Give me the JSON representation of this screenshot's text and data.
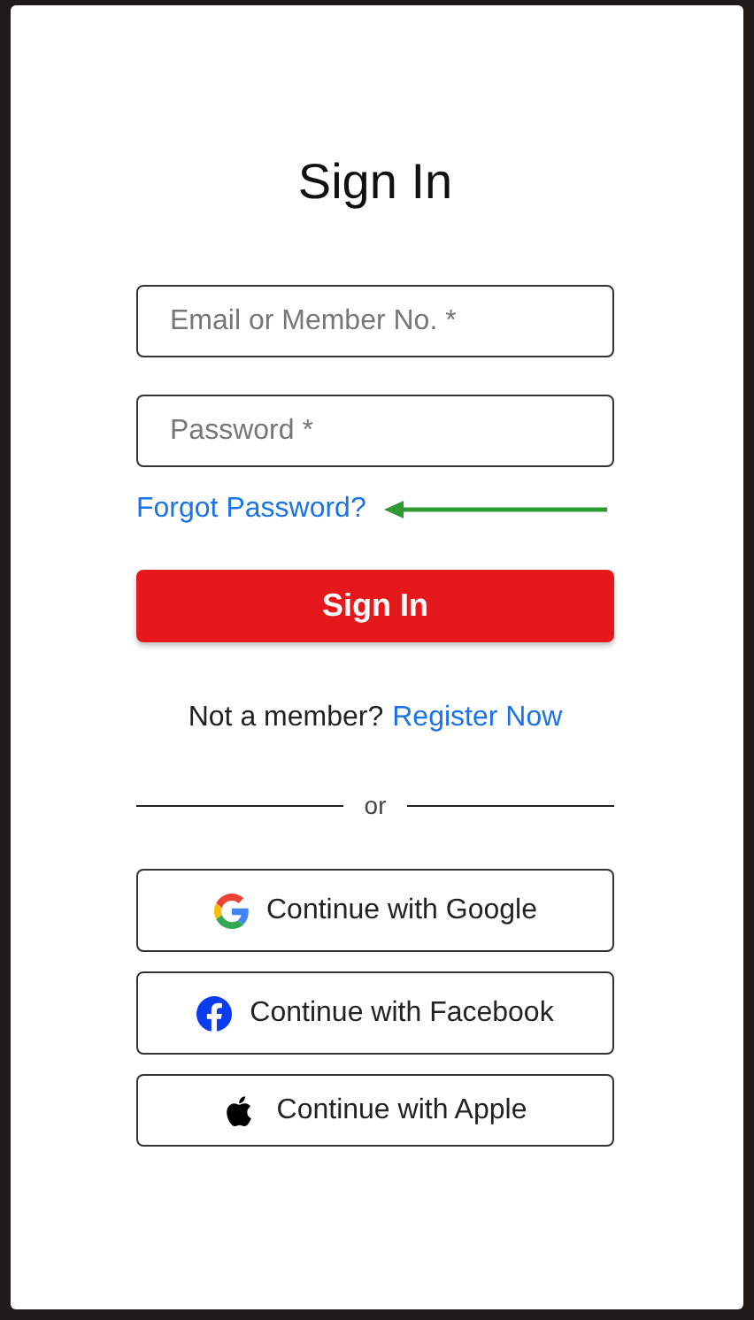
{
  "title": "Sign In",
  "fields": [
    {
      "placeholder": "Email or Member No. *"
    },
    {
      "placeholder": "Password *"
    }
  ],
  "forgot_link": "Forgot Password?",
  "annotation": {
    "kind": "arrow",
    "color": "#2e9a34"
  },
  "submit_button": "Sign In",
  "register": {
    "prompt": "Not a member?",
    "link": "Register Now"
  },
  "divider": "or",
  "social_buttons": [
    {
      "kind": "google",
      "label": "Continue with Google"
    },
    {
      "kind": "facebook",
      "label": "Continue with Facebook"
    },
    {
      "kind": "apple",
      "label": "Continue with Apple"
    }
  ]
}
